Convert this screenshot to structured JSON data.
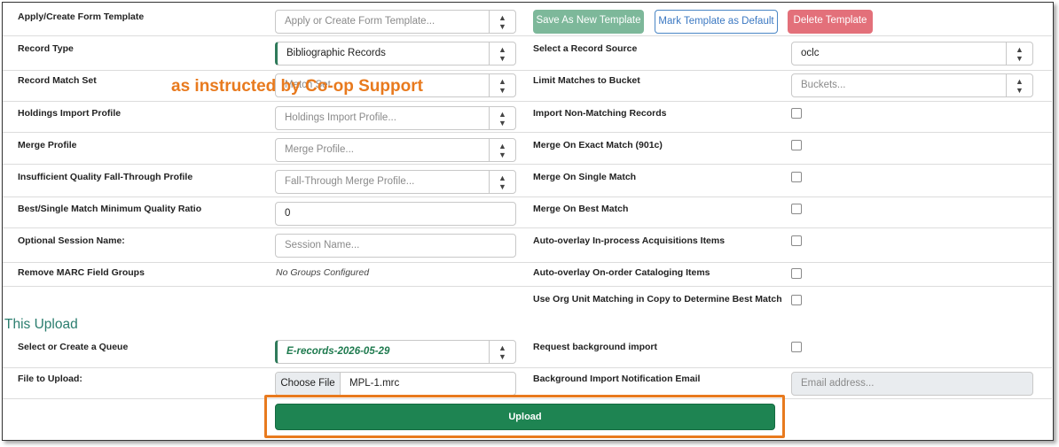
{
  "template": {
    "label": "Apply/Create Form Template",
    "placeholder": "Apply or Create Form Template...",
    "save_new": "Save As New Template",
    "mark_default": "Mark Template as Default",
    "delete": "Delete Template"
  },
  "left_rows": {
    "record_type": {
      "label": "Record Type",
      "value": "Bibliographic Records"
    },
    "match_set": {
      "label": "Record Match Set",
      "placeholder": "Match Set"
    },
    "holdings": {
      "label": "Holdings Import Profile",
      "placeholder": "Holdings Import Profile..."
    },
    "merge": {
      "label": "Merge Profile",
      "placeholder": "Merge Profile..."
    },
    "fallthrough": {
      "label": "Insufficient Quality Fall-Through Profile",
      "placeholder": "Fall-Through Merge Profile..."
    },
    "ratio": {
      "label": "Best/Single Match Minimum Quality Ratio",
      "value": "0"
    },
    "session": {
      "label": "Optional Session Name:",
      "placeholder": "Session Name..."
    },
    "marc_groups": {
      "label": "Remove MARC Field Groups",
      "value": "No Groups Configured"
    }
  },
  "right_rows": {
    "record_source": {
      "label": "Select a Record Source",
      "value": "oclc"
    },
    "bucket": {
      "label": "Limit Matches to Bucket",
      "placeholder": "Buckets..."
    },
    "non_matching": {
      "label": "Import Non-Matching Records"
    },
    "exact_match": {
      "label": "Merge On Exact Match (901c)"
    },
    "single_match": {
      "label": "Merge On Single Match"
    },
    "best_match": {
      "label": "Merge On Best Match"
    },
    "inprocess": {
      "label": "Auto-overlay In-process Acquisitions Items"
    },
    "onorder": {
      "label": "Auto-overlay On-order Cataloging Items"
    },
    "org_unit": {
      "label": "Use Org Unit Matching in Copy to Determine Best Match"
    },
    "background": {
      "label": "Request background import"
    },
    "notify_email": {
      "label": "Background Import Notification Email",
      "placeholder": "Email address..."
    }
  },
  "upload_section": {
    "heading": "This Upload",
    "queue": {
      "label": "Select or Create a Queue",
      "value": "E-records-2026-05-29"
    },
    "file": {
      "label": "File to Upload:",
      "choose": "Choose File",
      "filename": "MPL-1.mrc"
    },
    "upload_button": "Upload"
  },
  "annotation": {
    "text": "as instructed by Co-op Support",
    "color": "#e87a1e"
  },
  "colors": {
    "accent_green": "#1e8452",
    "teal": "#2a7d6e",
    "danger": "#e3707a",
    "highlight": "#e87a1e"
  }
}
